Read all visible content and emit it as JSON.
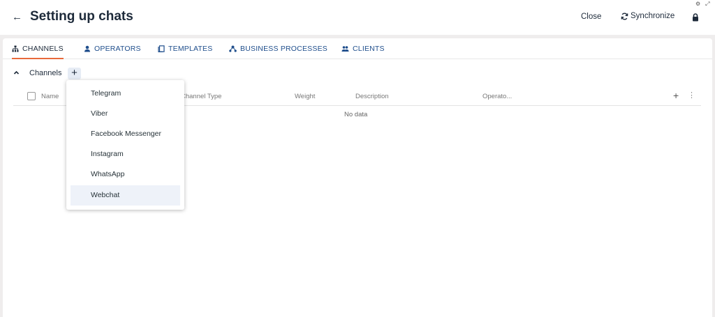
{
  "header": {
    "back_icon": "arrow-left-icon",
    "title": "Setting up chats",
    "close_label": "Close",
    "sync_label": "Synchronize",
    "sync_icon": "refresh-icon",
    "lock_icon": "lock-icon"
  },
  "tabs": [
    {
      "label": "CHANNELS",
      "icon": "hierarchy-icon",
      "active": true
    },
    {
      "label": "OPERATORS",
      "icon": "operator-icon",
      "active": false
    },
    {
      "label": "TEMPLATES",
      "icon": "template-icon",
      "active": false
    },
    {
      "label": "BUSINESS PROCESSES",
      "icon": "process-icon",
      "active": false
    },
    {
      "label": "CLIENTS",
      "icon": "clients-icon",
      "active": false
    }
  ],
  "section": {
    "title": "Channels",
    "collapse_icon": "chevron-up-icon",
    "add_icon": "plus-icon"
  },
  "table": {
    "columns": [
      "Name",
      "Channel Type",
      "Weight",
      "Description",
      "Operato..."
    ],
    "empty_text": "No data"
  },
  "dropdown": {
    "items": [
      "Telegram",
      "Viber",
      "Facebook Messenger",
      "Instagram",
      "WhatsApp",
      "Webchat"
    ],
    "highlighted": "Webchat"
  },
  "colors": {
    "accent": "#e8693a",
    "tab_text": "#1f4e8c",
    "hover": "#eef2f9"
  }
}
